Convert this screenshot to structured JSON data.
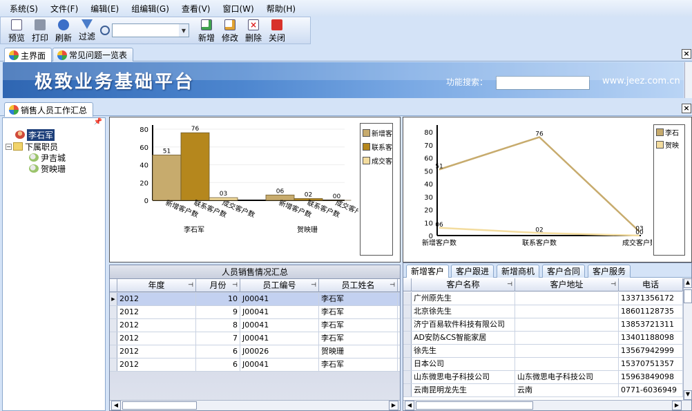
{
  "menu": [
    "系统(S)",
    "文件(F)",
    "编辑(E)",
    "组编辑(G)",
    "查看(V)",
    "窗口(W)",
    "帮助(H)"
  ],
  "toolbar": {
    "preview": "预览",
    "print": "打印",
    "refresh": "刷新",
    "filter": "过滤",
    "add": "新增",
    "edit": "修改",
    "delete": "删除",
    "close": "关闭",
    "combo_value": ""
  },
  "doc_tabs": [
    "主界面",
    "常见问题一览表"
  ],
  "banner": {
    "title": "极致业务基础平台",
    "search_label": "功能搜索：",
    "search_value": "",
    "url": "www.jeez.com.cn"
  },
  "sub_tab": "销售人员工作汇总",
  "tree": {
    "root": "李石军",
    "group": "下属职员",
    "children": [
      "尹吉城",
      "贺映珊"
    ]
  },
  "bar_chart": {
    "type": "bar",
    "groups": [
      "李石军",
      "贺映珊"
    ],
    "categories": [
      "新增客户数",
      "联系客户数",
      "成交客户数"
    ],
    "series": [
      {
        "group": "李石军",
        "values": [
          51,
          76,
          3
        ],
        "labels": [
          "51",
          "76",
          "03"
        ]
      },
      {
        "group": "贺映珊",
        "values": [
          6,
          2,
          0
        ],
        "labels": [
          "06",
          "02",
          "00"
        ]
      }
    ],
    "yticks": [
      "0",
      "20",
      "40",
      "60",
      "80"
    ],
    "ylim": [
      0,
      80
    ],
    "legend": [
      "新增客户数",
      "联系客户数",
      "成交客户数"
    ],
    "legend_shown": [
      "新增客",
      "联系客",
      "成交客"
    ],
    "colors": [
      "#c7ab6d",
      "#b5871d",
      "#f3dc9e"
    ]
  },
  "line_chart": {
    "type": "line",
    "categories": [
      "新增客户数",
      "联系客户数",
      "成交客户数"
    ],
    "series": [
      {
        "name": "李石军",
        "values": [
          51,
          76,
          3
        ],
        "labels": [
          "51",
          "76",
          "03"
        ]
      },
      {
        "name": "贺映珊",
        "values": [
          6,
          2,
          0
        ],
        "labels": [
          "06",
          "02",
          "00"
        ]
      }
    ],
    "yticks": [
      "0",
      "10",
      "20",
      "30",
      "40",
      "50",
      "60",
      "70",
      "80"
    ],
    "ylim": [
      0,
      80
    ],
    "legend_shown": [
      "李石",
      "贺映"
    ],
    "colors": [
      "#c7ab6d",
      "#f3dc9e"
    ]
  },
  "left_grid": {
    "caption": "人员销售情况汇总",
    "columns": [
      "年度",
      "月份",
      "员工编号",
      "员工姓名"
    ],
    "rows": [
      [
        "2012",
        "10",
        "J00041",
        "李石军"
      ],
      [
        "2012",
        "9",
        "J00041",
        "李石军"
      ],
      [
        "2012",
        "8",
        "J00041",
        "李石军"
      ],
      [
        "2012",
        "7",
        "J00041",
        "李石军"
      ],
      [
        "2012",
        "6",
        "J00026",
        "贺映珊"
      ],
      [
        "2012",
        "6",
        "J00041",
        "李石军"
      ]
    ]
  },
  "right_grid": {
    "tabs": [
      "新增客户",
      "客户跟进",
      "新增商机",
      "客户合同",
      "客户服务"
    ],
    "columns": [
      "客户名称",
      "客户地址",
      "电话"
    ],
    "rows": [
      [
        "广州原先生",
        "",
        "13371356172"
      ],
      [
        "北京徐先生",
        "",
        "18601128735"
      ],
      [
        "济宁百易软件科技有限公司",
        "",
        "13853721311"
      ],
      [
        "AD安防&CS智能家居",
        "",
        "13401188098"
      ],
      [
        "徐先生",
        "",
        "13567942999"
      ],
      [
        "日本公司",
        "",
        "15370751357"
      ],
      [
        "山东微思电子科技公司",
        "山东微思电子科技公司",
        "15963849098"
      ],
      [
        "云南昆明龙先生",
        "云南",
        "0771-6036949"
      ]
    ]
  }
}
